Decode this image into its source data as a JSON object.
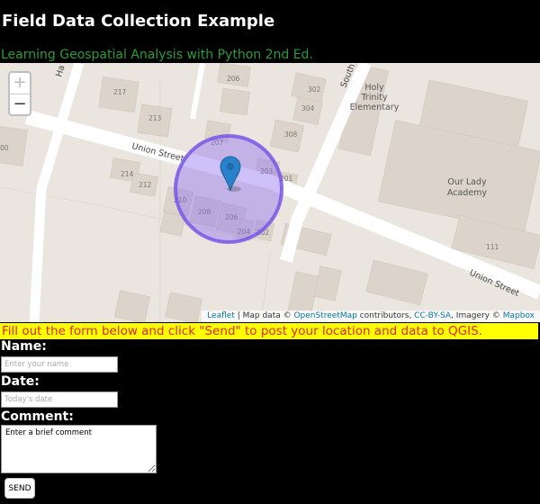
{
  "page": {
    "title": "Field Data Collection Example",
    "subtitle": "Learning Geospatial Analysis with Python 2nd Ed."
  },
  "map": {
    "zoom_in_label": "+",
    "zoom_out_label": "−",
    "street_labels": {
      "union_street_1": "Union Street",
      "union_street_2": "Union Street",
      "south_street": "South",
      "harris_street": "Ha"
    },
    "place_labels": {
      "holy_trinity": [
        "Holy",
        "Trinity",
        "Elementary"
      ],
      "our_lady": [
        "Our Lady",
        "Academy"
      ]
    },
    "building_numbers": [
      "217",
      "206",
      "302",
      "304",
      "213",
      "308",
      "207",
      "214",
      "212",
      "203",
      "201",
      "210",
      "208",
      "206",
      "204",
      "202",
      "111",
      "00"
    ],
    "attribution": {
      "leaflet": "Leaflet",
      "map_data": " | Map data © ",
      "osm": "OpenStreetMap",
      "contributors": " contributors, ",
      "license": "CC-BY-SA",
      "imagery": ", Imagery © ",
      "mapbox": "Mapbox"
    },
    "colors": {
      "background": "#eae6df",
      "building": "#dcd4ca",
      "road": "#ffffff",
      "circle_fill": "#8a6cf0",
      "circle_stroke": "#7a55e8",
      "marker": "#2a81cb"
    }
  },
  "instructions": "Fill out the form below and click \"Send\" to post your location and data to QGIS.",
  "form": {
    "name_label": "Name:",
    "name_placeholder": "Enter your name",
    "date_label": "Date:",
    "date_placeholder": "Today's date",
    "comment_label": "Comment:",
    "comment_placeholder": "Enter a brief comment",
    "send_label": "SEND"
  }
}
